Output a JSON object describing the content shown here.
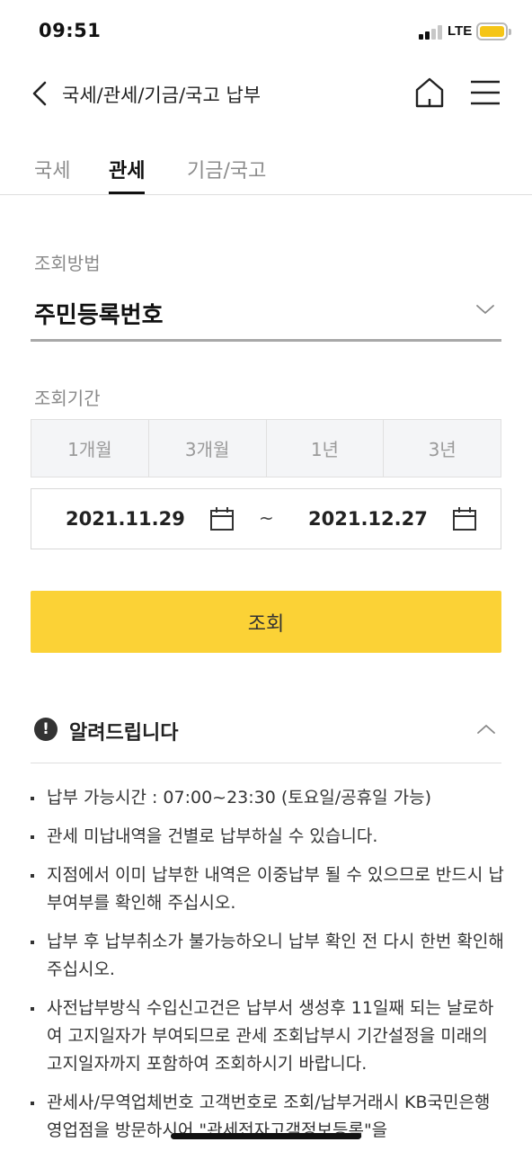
{
  "status_bar": {
    "time": "09:51",
    "network": "LTE"
  },
  "header": {
    "title": "국세/관세/기금/국고 납부"
  },
  "tabs": [
    {
      "label": "국세"
    },
    {
      "label": "관세"
    },
    {
      "label": "기금/국고"
    }
  ],
  "active_tab": "관세",
  "search_method": {
    "label": "조회방법",
    "value": "주민등록번호"
  },
  "period": {
    "label": "조회기간",
    "options": [
      "1개월",
      "3개월",
      "1년",
      "3년"
    ],
    "start_date": "2021.11.29",
    "separator": "~",
    "end_date": "2021.12.27"
  },
  "search_button": "조회",
  "notice": {
    "title": "알려드립니다",
    "icon_text": "!",
    "items": [
      "납부 가능시간 : 07:00~23:30 (토요일/공휴일 가능)",
      "관세 미납내역을 건별로 납부하실 수 있습니다.",
      "지점에서 이미 납부한 내역은 이중납부 될 수 있으므로 반드시 납부여부를 확인해 주십시오.",
      "납부 후 납부취소가 불가능하오니 납부 확인 전 다시 한번 확인해 주십시오.",
      "사전납부방식 수입신고건은 납부서 생성후 11일째 되는 날로하여 고지일자가 부여되므로 관세 조회납부시 기간설정을 미래의 고지일자까지 포함하여 조회하시기 바랍니다.",
      "관세사/무역업체번호 고객번호로 조회/납부거래시 KB국민은행 영업점을 방문하시어 \"관세전자고객정보등록\"을"
    ]
  },
  "colors": {
    "accent": "#fbd236",
    "battery": "#f5c518",
    "text": "#222222",
    "muted": "#8a8a8a"
  }
}
